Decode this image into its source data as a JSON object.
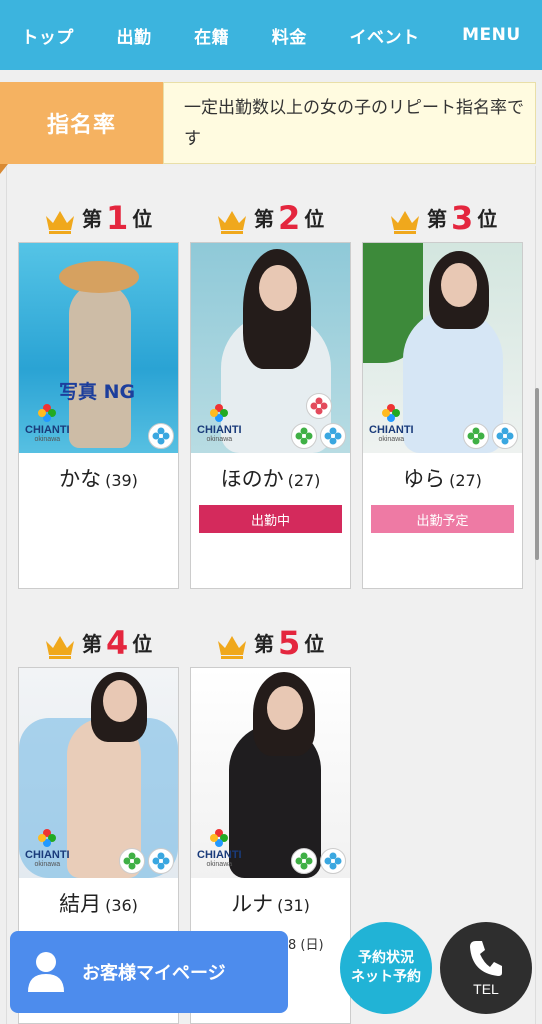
{
  "nav": [
    "トップ",
    "出勤",
    "在籍",
    "料金",
    "イベント",
    "MENU"
  ],
  "section": {
    "badge": "指名率",
    "description": "一定出勤数以上の女の子のリピート指名率です"
  },
  "rank_words": {
    "prefix": "第",
    "suffix": "位"
  },
  "cards": [
    {
      "rank": "1",
      "name": "かな",
      "age": "(39)",
      "status": "",
      "photo_note": "写真 NG"
    },
    {
      "rank": "2",
      "name": "ほのか",
      "age": "(27)",
      "status": "出勤中"
    },
    {
      "rank": "3",
      "name": "ゆら",
      "age": "(27)",
      "status": "出勤予定"
    },
    {
      "rank": "4",
      "name": "結月",
      "age": "(36)",
      "status": ""
    },
    {
      "rank": "5",
      "name": "ルナ",
      "age": "(31)",
      "status": ""
    }
  ],
  "brand": {
    "name": "CHIANTI",
    "sub": "okinawa"
  },
  "peek_text": "8 (日)",
  "floating": {
    "mypage_label": "お客様マイページ",
    "reserve_line1": "予約状況",
    "reserve_line2": "ネット予約",
    "tel_label": "TEL"
  },
  "colors": {
    "nav_bg": "#3cb4de",
    "badge_bg": "#f5b261",
    "rank_number": "#e4263e",
    "status_on": "#d42a5c",
    "status_plan": "#ee7aa4",
    "mypage_bg": "#4d8ced"
  }
}
